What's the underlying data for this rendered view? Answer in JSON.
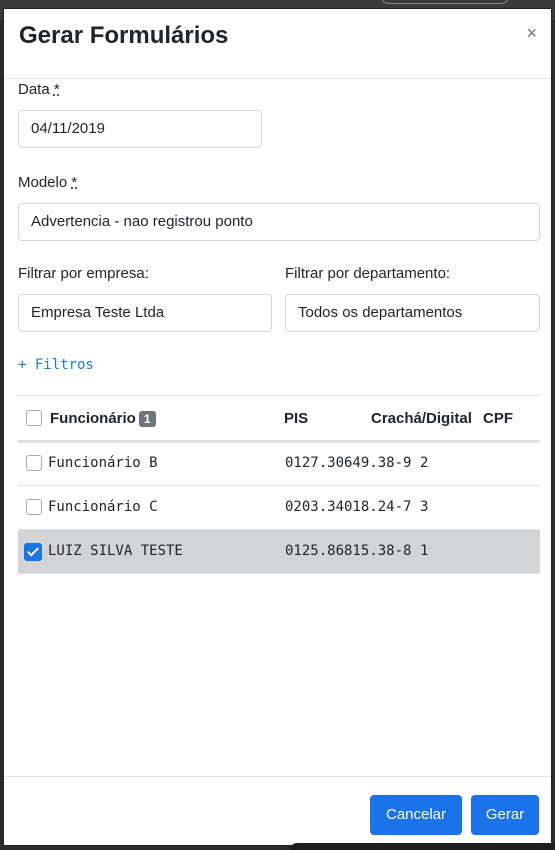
{
  "modal": {
    "title": "Gerar Formulários",
    "close_glyph": "×"
  },
  "form": {
    "date_label": "Data",
    "required_mark": "*",
    "date_value": "04/11/2019",
    "model_label": "Modelo",
    "model_value": "Advertencia - nao registrou ponto",
    "company_label": "Filtrar por empresa:",
    "company_value": "Empresa Teste Ltda",
    "department_label": "Filtrar por departamento:",
    "department_value": "Todos os departamentos",
    "filters_link": "+ Filtros"
  },
  "table": {
    "headers": {
      "employee": "Funcionário",
      "count_badge": "1",
      "pis": "PIS",
      "badge_digital": "Crachá/Digital",
      "cpf": "CPF"
    },
    "rows": [
      {
        "name": "Funcionário B",
        "pis": "0127.30649.38-9",
        "badge": "2",
        "cpf": "",
        "checked": false
      },
      {
        "name": "Funcionário C",
        "pis": "0203.34018.24-7",
        "badge": "3",
        "cpf": "",
        "checked": false
      },
      {
        "name": "LUIZ SILVA TESTE",
        "pis": "0125.86815.38-8",
        "badge": "1",
        "cpf": "",
        "checked": true
      }
    ]
  },
  "footer": {
    "cancel_label": "Cancelar",
    "generate_label": "Gerar"
  },
  "colors": {
    "primary": "#1a73e8",
    "selected_row": "#d2d4d6",
    "link": "#1a7fd4"
  }
}
